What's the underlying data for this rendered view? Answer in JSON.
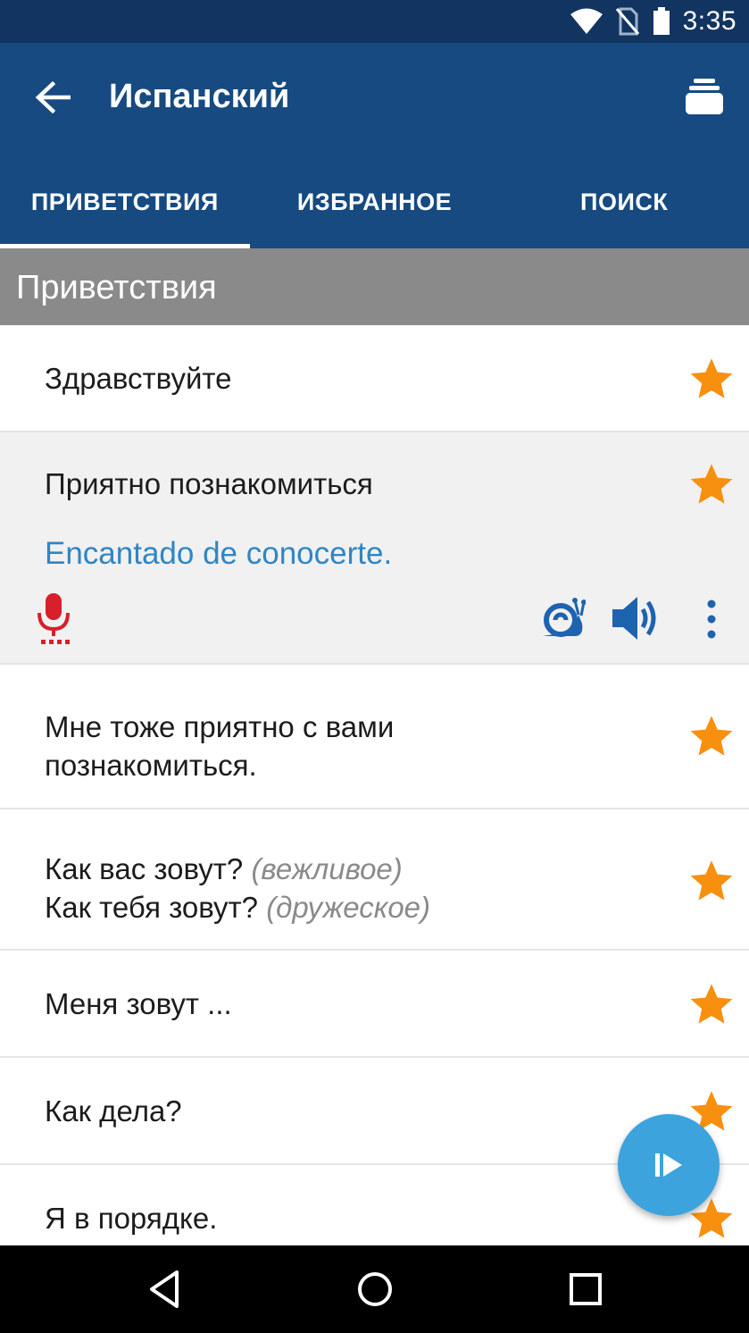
{
  "status_bar": {
    "time": "3:35"
  },
  "app_bar": {
    "title": "Испанский",
    "back_icon": "arrow-left-icon",
    "deck_icon": "flashcards-icon",
    "tabs": [
      {
        "label": "ПРИВЕТСТВИЯ",
        "active": true
      },
      {
        "label": "ИЗБРАННОЕ",
        "active": false
      },
      {
        "label": "ПОИСК",
        "active": false
      }
    ]
  },
  "section": {
    "title": "Приветствия"
  },
  "rows": [
    {
      "text": "Здравствуйте"
    },
    {
      "text": "Приятно познакомиться",
      "translation": "Encantado de conocerte."
    },
    {
      "line1": "Мне тоже приятно с вами",
      "line2": "познакомиться."
    },
    {
      "line1": "Как вас зовут?",
      "hint1": "(вежливое)",
      "line2": "Как тебя зовут?",
      "hint2": "(дружеское)"
    },
    {
      "text": "Меня зовут ..."
    },
    {
      "text": "Как дела?"
    },
    {
      "text": "Я в порядке."
    }
  ],
  "colors": {
    "status_bar": "#123460",
    "app_bar": "#164a80",
    "section_header": "#8a8a8a",
    "star": "#f7900f",
    "translation": "#2f86c5",
    "mic": "#d8202a",
    "audio_icons": "#1e63b0",
    "fab": "#3da3dc"
  }
}
